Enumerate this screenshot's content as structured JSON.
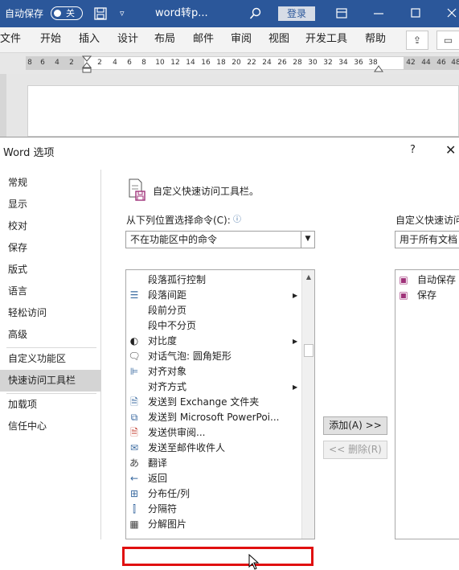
{
  "titlebar": {
    "autosave_label": "自动保存",
    "autosave_state": "关",
    "doc_name": "word转p...",
    "login": "登录",
    "icons": [
      "save-icon",
      "customize-arrow-icon",
      "search-icon",
      "ribbon-display-icon",
      "minimize-icon",
      "maximize-icon"
    ]
  },
  "ribbon": {
    "tabs": [
      "文件",
      "开始",
      "插入",
      "设计",
      "布局",
      "邮件",
      "审阅",
      "视图",
      "开发工具",
      "帮助"
    ]
  },
  "ruler": {
    "ticks": [
      "8",
      "6",
      "4",
      "2",
      "2",
      "4",
      "6",
      "8",
      "10",
      "12",
      "14",
      "16",
      "18",
      "20",
      "22",
      "24",
      "26",
      "28",
      "30",
      "32",
      "34",
      "36",
      "38",
      "42",
      "44",
      "46",
      "48"
    ]
  },
  "dialog": {
    "title": "Word 选项",
    "help": "?",
    "close": "✕",
    "nav": [
      {
        "label": "常规",
        "selected": false
      },
      {
        "label": "显示",
        "selected": false
      },
      {
        "label": "校对",
        "selected": false
      },
      {
        "label": "保存",
        "selected": false
      },
      {
        "label": "版式",
        "selected": false
      },
      {
        "label": "语言",
        "selected": false
      },
      {
        "label": "轻松访问",
        "selected": false
      },
      {
        "label": "高级",
        "selected": false
      },
      {
        "label": "自定义功能区",
        "selected": false
      },
      {
        "label": "快速访问工具栏",
        "selected": true
      },
      {
        "label": "加载项",
        "selected": false
      },
      {
        "label": "信任中心",
        "selected": false
      }
    ],
    "header_text": "自定义快速访问工具栏。",
    "choose_label": "从下列位置选择命令(C):",
    "choose_value": "不在功能区中的命令",
    "customize_label": "自定义快速访问",
    "customize_value": "用于所有文档",
    "commands": [
      {
        "label": "段落孤行控制",
        "icon": "",
        "submenu": false
      },
      {
        "label": "段落间距",
        "icon": "paragraph-spacing-icon",
        "submenu": true
      },
      {
        "label": "段前分页",
        "icon": "",
        "submenu": false
      },
      {
        "label": "段中不分页",
        "icon": "",
        "submenu": false
      },
      {
        "label": "对比度",
        "icon": "contrast-icon",
        "submenu": true
      },
      {
        "label": "对话气泡: 圆角矩形",
        "icon": "speech-bubble-icon",
        "submenu": false
      },
      {
        "label": "对齐对象",
        "icon": "align-objects-icon",
        "submenu": false
      },
      {
        "label": "对齐方式",
        "icon": "",
        "submenu": true
      },
      {
        "label": "发送到 Exchange 文件夹",
        "icon": "send-exchange-icon",
        "submenu": false
      },
      {
        "label": "发送到 Microsoft PowerPoi...",
        "icon": "send-powerpoint-icon",
        "submenu": false
      },
      {
        "label": "发送供审阅...",
        "icon": "send-review-icon",
        "submenu": false
      },
      {
        "label": "发送至邮件收件人",
        "icon": "send-mail-icon",
        "submenu": false
      },
      {
        "label": "翻译",
        "icon": "translate-icon",
        "submenu": false
      },
      {
        "label": "返回",
        "icon": "back-arrow-icon",
        "submenu": false
      },
      {
        "label": "分布任/列",
        "icon": "distribute-icon",
        "submenu": false
      },
      {
        "label": "分隔符",
        "icon": "separator-icon",
        "submenu": false
      },
      {
        "label": "分解图片",
        "icon": "ungroup-picture-icon",
        "submenu": false
      }
    ],
    "add_button": "添加(A) >>",
    "remove_button": "<< 删除(R)",
    "toolbar_items": [
      {
        "label": "自动保存",
        "icon": "autosave-icon"
      },
      {
        "label": "保存",
        "icon": "save-icon"
      }
    ]
  }
}
